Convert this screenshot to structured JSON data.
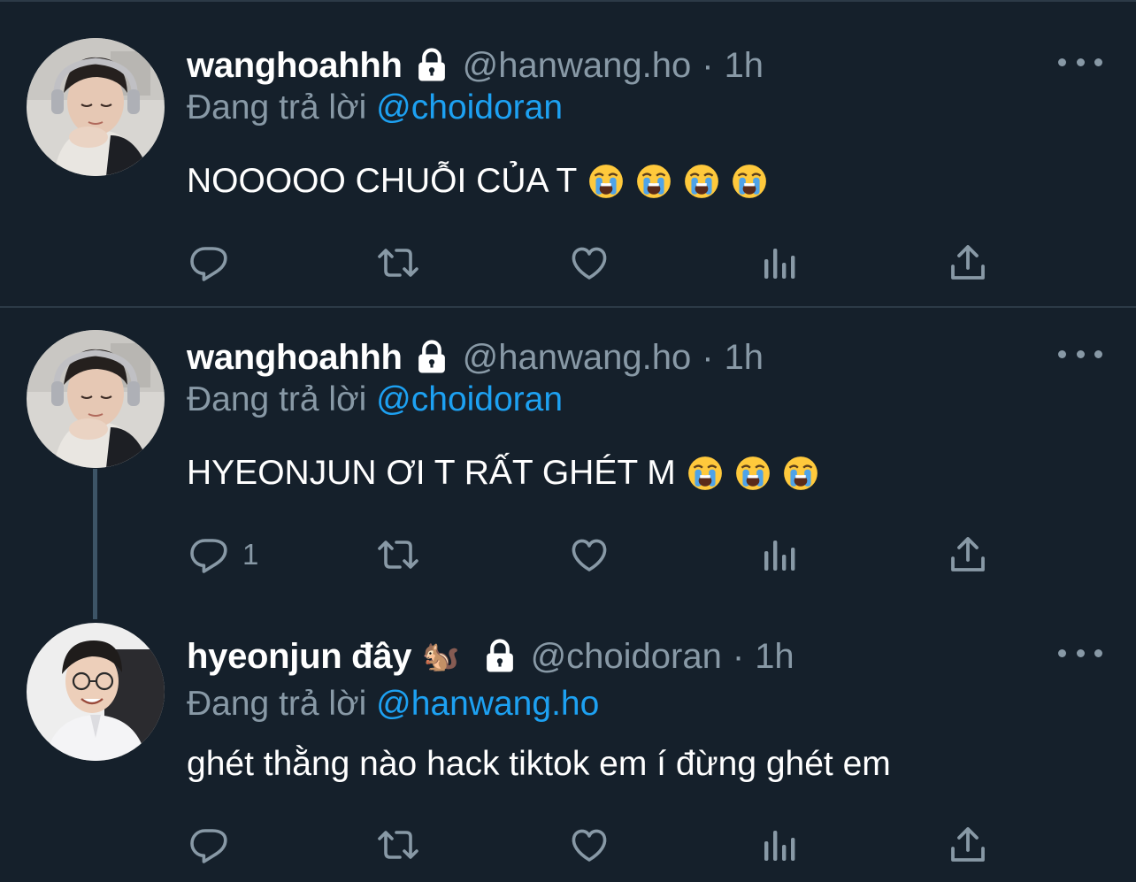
{
  "tweets": [
    {
      "name": "wanghoahhh",
      "name_emoji": "",
      "handle": "@hanwang.ho",
      "separator": "·",
      "time": "1h",
      "replying_prefix": "Đang trả lời",
      "replying_to": "@choidoran",
      "text": "NOOOOO CHUỖI CỦA T",
      "emoji_count": 4,
      "reply_count": "",
      "icons": [
        "lock-icon",
        "crying-face-emoji"
      ]
    },
    {
      "name": "wanghoahhh",
      "name_emoji": "",
      "handle": "@hanwang.ho",
      "separator": "·",
      "time": "1h",
      "replying_prefix": "Đang trả lời",
      "replying_to": "@choidoran",
      "text": "HYEONJUN ƠI T RẤT GHÉT M",
      "emoji_count": 3,
      "reply_count": "1",
      "icons": [
        "lock-icon",
        "crying-face-emoji"
      ]
    },
    {
      "name": "hyeonjun đây",
      "name_emoji": "🐿️",
      "handle": "@choidoran",
      "separator": "·",
      "time": "1h",
      "replying_prefix": "Đang trả lời",
      "replying_to": "@hanwang.ho",
      "text": "ghét thằng nào hack tiktok em í đừng ghét em",
      "emoji_count": 0,
      "reply_count": "",
      "icons": [
        "lock-icon"
      ]
    }
  ],
  "action_icons": [
    "reply-icon",
    "retweet-icon",
    "like-icon",
    "analytics-icon",
    "share-icon"
  ],
  "colors": {
    "background": "#15202b",
    "divider": "#2c3a47",
    "secondary_text": "#8899a6",
    "link": "#1da1f2",
    "primary_text": "#ffffff"
  }
}
